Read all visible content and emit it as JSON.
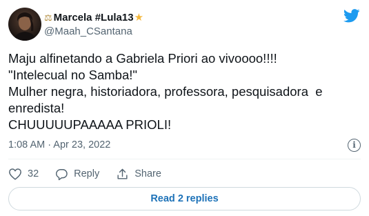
{
  "author": {
    "display_name": "Marcela #Lula13",
    "name_prefix_emoji": "⚖",
    "name_suffix_emoji": "★",
    "handle": "@Maah_CSantana",
    "avatar_icon": "avatar-photo"
  },
  "tweet": {
    "text": "Maju alfinetando a Gabriela Priori ao vivoooo!!!!\n\"Intelecual no Samba!\"\nMulher negra, historiadora, professora, pesquisadora  e\nenredista!\nCHUUUUUPAAAAA PRIOLI!",
    "timestamp": "1:08 AM · Apr 23, 2022"
  },
  "actions": {
    "like_count": "32",
    "reply_label": "Reply",
    "share_label": "Share"
  },
  "replies_button": "Read 2 replies",
  "colors": {
    "accent": "#1d9bf0",
    "link": "#1d72b8",
    "muted": "#536471",
    "text": "#0f1419"
  }
}
